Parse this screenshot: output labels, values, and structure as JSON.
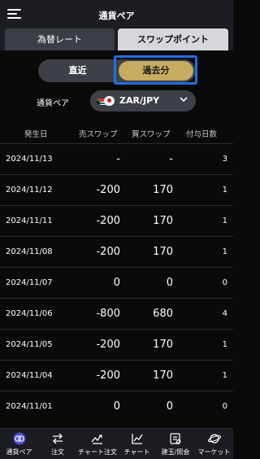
{
  "header": {
    "title": "通貨ペア"
  },
  "tabs": [
    {
      "label": "為替レート"
    },
    {
      "label": "スワップポイント"
    }
  ],
  "period_toggle": {
    "recent": "直近",
    "past": "過去分"
  },
  "pair": {
    "label": "通貨ペア",
    "value": "ZAR/JPY"
  },
  "table": {
    "headers": [
      "発生日",
      "売スワップ",
      "買スワップ",
      "付与日数"
    ],
    "rows": [
      {
        "date": "2024/11/13",
        "sell": "-",
        "buy": "-",
        "days": "3"
      },
      {
        "date": "2024/11/12",
        "sell": "-200",
        "buy": "170",
        "days": "1"
      },
      {
        "date": "2024/11/11",
        "sell": "-200",
        "buy": "170",
        "days": "1"
      },
      {
        "date": "2024/11/08",
        "sell": "-200",
        "buy": "170",
        "days": "1"
      },
      {
        "date": "2024/11/07",
        "sell": "0",
        "buy": "0",
        "days": "0"
      },
      {
        "date": "2024/11/06",
        "sell": "-800",
        "buy": "680",
        "days": "4"
      },
      {
        "date": "2024/11/05",
        "sell": "-200",
        "buy": "170",
        "days": "1"
      },
      {
        "date": "2024/11/04",
        "sell": "-200",
        "buy": "170",
        "days": "1"
      },
      {
        "date": "2024/11/01",
        "sell": "0",
        "buy": "0",
        "days": "0"
      }
    ]
  },
  "bottom_nav": [
    {
      "label": "通貨ペア",
      "icon": "currency-pair-icon"
    },
    {
      "label": "注文",
      "icon": "order-arrows-icon"
    },
    {
      "label": "チャート注文",
      "icon": "chart-order-icon"
    },
    {
      "label": "チャート",
      "icon": "chart-icon"
    },
    {
      "label": "建玉/照会",
      "icon": "positions-icon"
    },
    {
      "label": "マーケット",
      "icon": "market-icon"
    }
  ],
  "colors": {
    "accent_gold": "#c6ab61",
    "highlight_blue": "#1f6fe0"
  }
}
